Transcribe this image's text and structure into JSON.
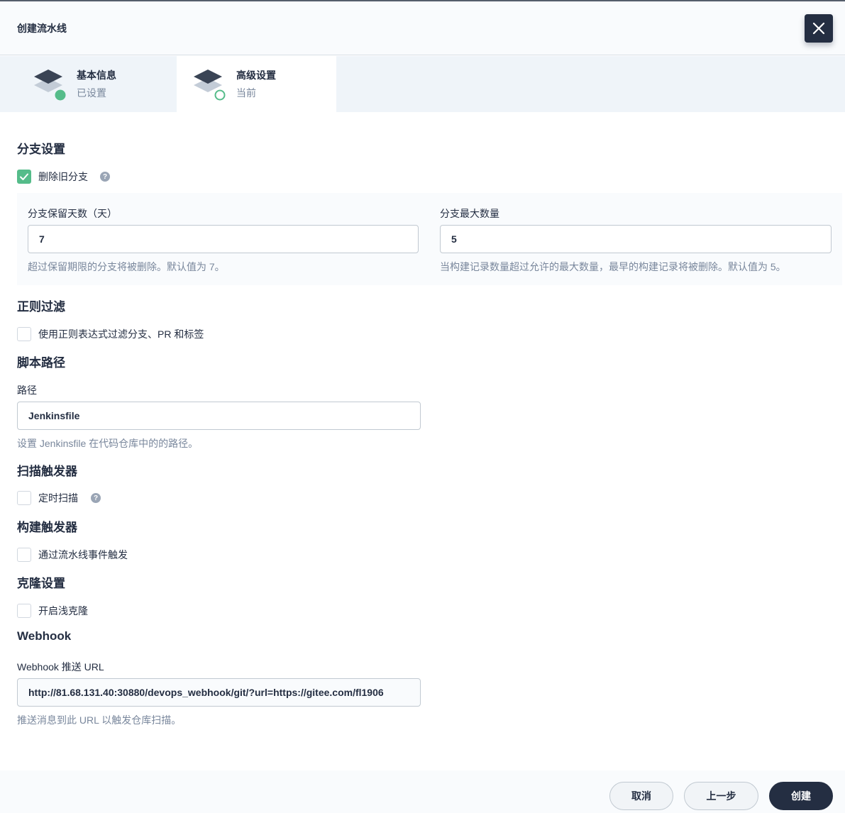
{
  "header": {
    "title": "创建流水线"
  },
  "tabs": [
    {
      "title": "基本信息",
      "status": "已设置"
    },
    {
      "title": "高级设置",
      "status": "当前"
    }
  ],
  "branch": {
    "section_title": "分支设置",
    "delete_old_label": "删除旧分支",
    "delete_old_checked": true,
    "days_label": "分支保留天数（天）",
    "days_value": "7",
    "days_hint": "超过保留期限的分支将被删除。默认值为 7。",
    "max_label": "分支最大数量",
    "max_value": "5",
    "max_hint": "当构建记录数量超过允许的最大数量，最早的构建记录将被删除。默认值为 5。"
  },
  "regex": {
    "section_title": "正则过滤",
    "checkbox_label": "使用正则表达式过滤分支、PR 和标签"
  },
  "script": {
    "section_title": "脚本路径",
    "path_label": "路径",
    "path_value": "Jenkinsfile",
    "path_hint": "设置 Jenkinsfile 在代码仓库中的的路径。"
  },
  "scan": {
    "section_title": "扫描触发器",
    "checkbox_label": "定时扫描"
  },
  "build": {
    "section_title": "构建触发器",
    "checkbox_label": "通过流水线事件触发"
  },
  "clone": {
    "section_title": "克隆设置",
    "checkbox_label": "开启浅克隆"
  },
  "webhook": {
    "section_title": "Webhook",
    "url_label": "Webhook 推送 URL",
    "url_value": "http://81.68.131.40:30880/devops_webhook/git/?url=https://gitee.com/fl1906",
    "url_hint": "推送消息到此 URL 以触发仓库扫描。"
  },
  "footer": {
    "cancel_label": "取消",
    "prev_label": "上一步",
    "create_label": "创建"
  },
  "colors": {
    "accent": "#55bc8a",
    "dark": "#242e42",
    "muted": "#79879c"
  }
}
